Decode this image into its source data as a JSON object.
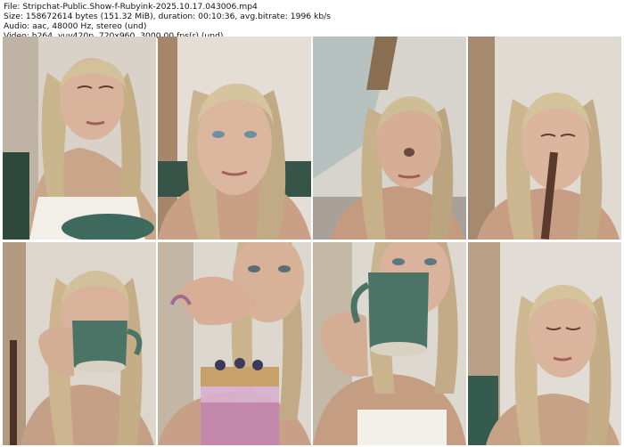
{
  "header": {
    "file": "File: Stripchat-Public.Show-f-Rubyink-2025.10.17.043006.mp4",
    "size": "Size: 158672614 bytes (151.32 MiB), duration: 00:10:36, avg.bitrate: 1996 kb/s",
    "audio": "Audio: aac, 48000 Hz, stereo (und)",
    "video": "Video: h264, yuv420p, 720x960, 3000.00 fps(r) (und)"
  },
  "frames": [
    {
      "id": 1,
      "scene": "woman-looking-down-cup"
    },
    {
      "id": 2,
      "scene": "woman-close-face"
    },
    {
      "id": 3,
      "scene": "woman-near-window"
    },
    {
      "id": 4,
      "scene": "woman-with-straw"
    },
    {
      "id": 5,
      "scene": "woman-sipping-mug"
    },
    {
      "id": 6,
      "scene": "woman-eating-parfait"
    },
    {
      "id": 7,
      "scene": "woman-drinking-mug-close"
    },
    {
      "id": 8,
      "scene": "woman-looking-down"
    }
  ]
}
